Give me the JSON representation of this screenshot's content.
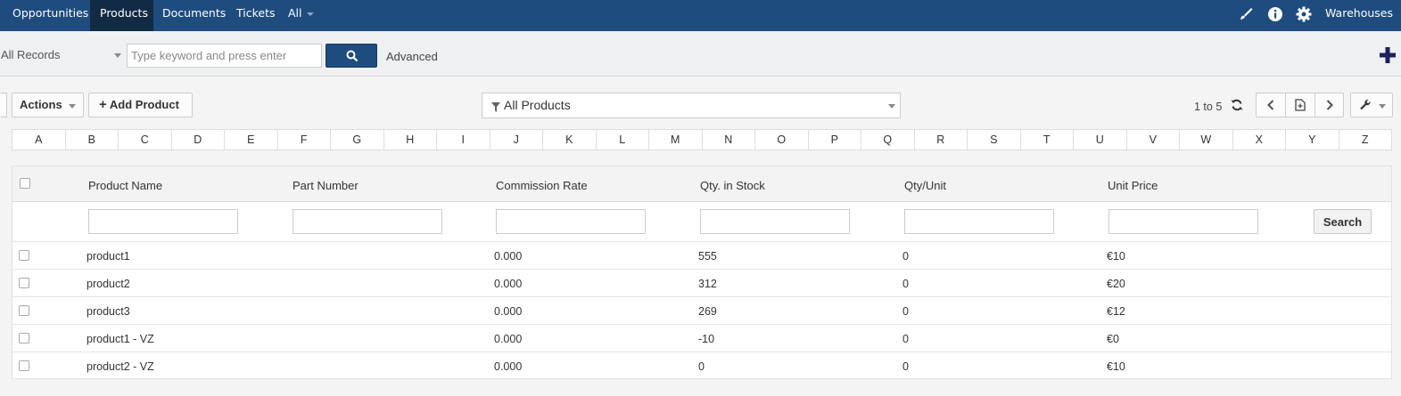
{
  "nav": {
    "items": [
      {
        "label": "Opportunities"
      },
      {
        "label": "Products"
      },
      {
        "label": "Documents"
      },
      {
        "label": "Tickets"
      },
      {
        "label": "All"
      }
    ],
    "right_label": "Warehouses",
    "icons": [
      "brush-icon",
      "info-icon",
      "gear-icon"
    ]
  },
  "search": {
    "records_option": "All Records",
    "placeholder": "Type keyword and press enter",
    "value": "",
    "advanced_label": "Advanced"
  },
  "toolbar": {
    "actions_label": "Actions",
    "add_label": "Add Product",
    "filter_value": "All Products",
    "pager_text": "1 to 5"
  },
  "alphabet": [
    "A",
    "B",
    "C",
    "D",
    "E",
    "F",
    "G",
    "H",
    "I",
    "J",
    "K",
    "L",
    "M",
    "N",
    "O",
    "P",
    "Q",
    "R",
    "S",
    "T",
    "U",
    "V",
    "W",
    "X",
    "Y",
    "Z"
  ],
  "table": {
    "columns": [
      "Product Name",
      "Part Number",
      "Commission Rate",
      "Qty. in Stock",
      "Qty/Unit",
      "Unit Price"
    ],
    "search_label": "Search",
    "rows": [
      {
        "name": "product1",
        "part": "",
        "commission": "0.000",
        "stock": "555",
        "qty_unit": "0",
        "price": "€10"
      },
      {
        "name": "product2",
        "part": "",
        "commission": "0.000",
        "stock": "312",
        "qty_unit": "0",
        "price": "€20"
      },
      {
        "name": "product3",
        "part": "",
        "commission": "0.000",
        "stock": "269",
        "qty_unit": "0",
        "price": "€12"
      },
      {
        "name": "product1 - VZ",
        "part": "",
        "commission": "0.000",
        "stock": "-10",
        "qty_unit": "0",
        "price": "€0"
      },
      {
        "name": "product2 - VZ",
        "part": "",
        "commission": "0.000",
        "stock": "0",
        "qty_unit": "0",
        "price": "€10"
      }
    ]
  },
  "colors": {
    "nav_bg": "#1e4c7f",
    "nav_active": "#122b44",
    "accent": "#1e4c7f"
  }
}
